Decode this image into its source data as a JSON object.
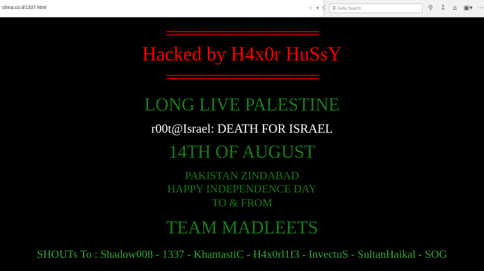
{
  "browser": {
    "url": "shina.co.il/1337.html",
    "url_actions": "☆ ▾ C",
    "search_placeholder": "Delta Search",
    "search_engine_icon": "search-icon"
  },
  "page": {
    "divider": "===================",
    "title": "Hacked by H4x0r HuSsY",
    "slogan": "LONG LIVE PALESTINE",
    "message": "r00t@Israel: DEATH FOR ISRAEL",
    "date": "14TH OF AUGUST",
    "lines": [
      "PAKISTAN ZINDABAD",
      "HAPPY INDEPENDENCE DAY",
      "TO & FROM"
    ],
    "team": "TEAM MADLEETS",
    "shouts": "SHOUTs To : Shadow008 - 1337 - KhantastiC - H4x0rl1f3 - InvectuS - SultanHaikal - SOG"
  },
  "colors": {
    "title": "#ff0000",
    "green": "#1c7d1c",
    "white": "#ffffff",
    "background": "#000000"
  }
}
